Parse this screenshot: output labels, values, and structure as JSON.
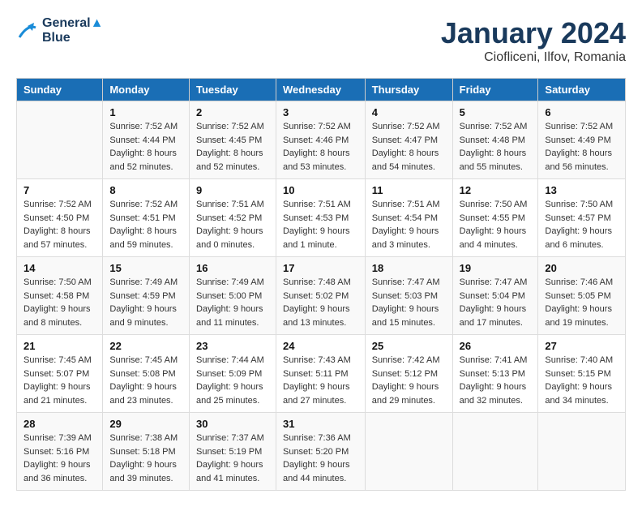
{
  "header": {
    "logo_line1": "General",
    "logo_line2": "Blue",
    "month": "January 2024",
    "location": "Ciofliceni, Ilfov, Romania"
  },
  "days_of_week": [
    "Sunday",
    "Monday",
    "Tuesday",
    "Wednesday",
    "Thursday",
    "Friday",
    "Saturday"
  ],
  "weeks": [
    [
      {
        "day": "",
        "sunrise": "",
        "sunset": "",
        "daylight": ""
      },
      {
        "day": "1",
        "sunrise": "Sunrise: 7:52 AM",
        "sunset": "Sunset: 4:44 PM",
        "daylight": "Daylight: 8 hours and 52 minutes."
      },
      {
        "day": "2",
        "sunrise": "Sunrise: 7:52 AM",
        "sunset": "Sunset: 4:45 PM",
        "daylight": "Daylight: 8 hours and 52 minutes."
      },
      {
        "day": "3",
        "sunrise": "Sunrise: 7:52 AM",
        "sunset": "Sunset: 4:46 PM",
        "daylight": "Daylight: 8 hours and 53 minutes."
      },
      {
        "day": "4",
        "sunrise": "Sunrise: 7:52 AM",
        "sunset": "Sunset: 4:47 PM",
        "daylight": "Daylight: 8 hours and 54 minutes."
      },
      {
        "day": "5",
        "sunrise": "Sunrise: 7:52 AM",
        "sunset": "Sunset: 4:48 PM",
        "daylight": "Daylight: 8 hours and 55 minutes."
      },
      {
        "day": "6",
        "sunrise": "Sunrise: 7:52 AM",
        "sunset": "Sunset: 4:49 PM",
        "daylight": "Daylight: 8 hours and 56 minutes."
      }
    ],
    [
      {
        "day": "7",
        "sunrise": "Sunrise: 7:52 AM",
        "sunset": "Sunset: 4:50 PM",
        "daylight": "Daylight: 8 hours and 57 minutes."
      },
      {
        "day": "8",
        "sunrise": "Sunrise: 7:52 AM",
        "sunset": "Sunset: 4:51 PM",
        "daylight": "Daylight: 8 hours and 59 minutes."
      },
      {
        "day": "9",
        "sunrise": "Sunrise: 7:51 AM",
        "sunset": "Sunset: 4:52 PM",
        "daylight": "Daylight: 9 hours and 0 minutes."
      },
      {
        "day": "10",
        "sunrise": "Sunrise: 7:51 AM",
        "sunset": "Sunset: 4:53 PM",
        "daylight": "Daylight: 9 hours and 1 minute."
      },
      {
        "day": "11",
        "sunrise": "Sunrise: 7:51 AM",
        "sunset": "Sunset: 4:54 PM",
        "daylight": "Daylight: 9 hours and 3 minutes."
      },
      {
        "day": "12",
        "sunrise": "Sunrise: 7:50 AM",
        "sunset": "Sunset: 4:55 PM",
        "daylight": "Daylight: 9 hours and 4 minutes."
      },
      {
        "day": "13",
        "sunrise": "Sunrise: 7:50 AM",
        "sunset": "Sunset: 4:57 PM",
        "daylight": "Daylight: 9 hours and 6 minutes."
      }
    ],
    [
      {
        "day": "14",
        "sunrise": "Sunrise: 7:50 AM",
        "sunset": "Sunset: 4:58 PM",
        "daylight": "Daylight: 9 hours and 8 minutes."
      },
      {
        "day": "15",
        "sunrise": "Sunrise: 7:49 AM",
        "sunset": "Sunset: 4:59 PM",
        "daylight": "Daylight: 9 hours and 9 minutes."
      },
      {
        "day": "16",
        "sunrise": "Sunrise: 7:49 AM",
        "sunset": "Sunset: 5:00 PM",
        "daylight": "Daylight: 9 hours and 11 minutes."
      },
      {
        "day": "17",
        "sunrise": "Sunrise: 7:48 AM",
        "sunset": "Sunset: 5:02 PM",
        "daylight": "Daylight: 9 hours and 13 minutes."
      },
      {
        "day": "18",
        "sunrise": "Sunrise: 7:47 AM",
        "sunset": "Sunset: 5:03 PM",
        "daylight": "Daylight: 9 hours and 15 minutes."
      },
      {
        "day": "19",
        "sunrise": "Sunrise: 7:47 AM",
        "sunset": "Sunset: 5:04 PM",
        "daylight": "Daylight: 9 hours and 17 minutes."
      },
      {
        "day": "20",
        "sunrise": "Sunrise: 7:46 AM",
        "sunset": "Sunset: 5:05 PM",
        "daylight": "Daylight: 9 hours and 19 minutes."
      }
    ],
    [
      {
        "day": "21",
        "sunrise": "Sunrise: 7:45 AM",
        "sunset": "Sunset: 5:07 PM",
        "daylight": "Daylight: 9 hours and 21 minutes."
      },
      {
        "day": "22",
        "sunrise": "Sunrise: 7:45 AM",
        "sunset": "Sunset: 5:08 PM",
        "daylight": "Daylight: 9 hours and 23 minutes."
      },
      {
        "day": "23",
        "sunrise": "Sunrise: 7:44 AM",
        "sunset": "Sunset: 5:09 PM",
        "daylight": "Daylight: 9 hours and 25 minutes."
      },
      {
        "day": "24",
        "sunrise": "Sunrise: 7:43 AM",
        "sunset": "Sunset: 5:11 PM",
        "daylight": "Daylight: 9 hours and 27 minutes."
      },
      {
        "day": "25",
        "sunrise": "Sunrise: 7:42 AM",
        "sunset": "Sunset: 5:12 PM",
        "daylight": "Daylight: 9 hours and 29 minutes."
      },
      {
        "day": "26",
        "sunrise": "Sunrise: 7:41 AM",
        "sunset": "Sunset: 5:13 PM",
        "daylight": "Daylight: 9 hours and 32 minutes."
      },
      {
        "day": "27",
        "sunrise": "Sunrise: 7:40 AM",
        "sunset": "Sunset: 5:15 PM",
        "daylight": "Daylight: 9 hours and 34 minutes."
      }
    ],
    [
      {
        "day": "28",
        "sunrise": "Sunrise: 7:39 AM",
        "sunset": "Sunset: 5:16 PM",
        "daylight": "Daylight: 9 hours and 36 minutes."
      },
      {
        "day": "29",
        "sunrise": "Sunrise: 7:38 AM",
        "sunset": "Sunset: 5:18 PM",
        "daylight": "Daylight: 9 hours and 39 minutes."
      },
      {
        "day": "30",
        "sunrise": "Sunrise: 7:37 AM",
        "sunset": "Sunset: 5:19 PM",
        "daylight": "Daylight: 9 hours and 41 minutes."
      },
      {
        "day": "31",
        "sunrise": "Sunrise: 7:36 AM",
        "sunset": "Sunset: 5:20 PM",
        "daylight": "Daylight: 9 hours and 44 minutes."
      },
      {
        "day": "",
        "sunrise": "",
        "sunset": "",
        "daylight": ""
      },
      {
        "day": "",
        "sunrise": "",
        "sunset": "",
        "daylight": ""
      },
      {
        "day": "",
        "sunrise": "",
        "sunset": "",
        "daylight": ""
      }
    ]
  ]
}
